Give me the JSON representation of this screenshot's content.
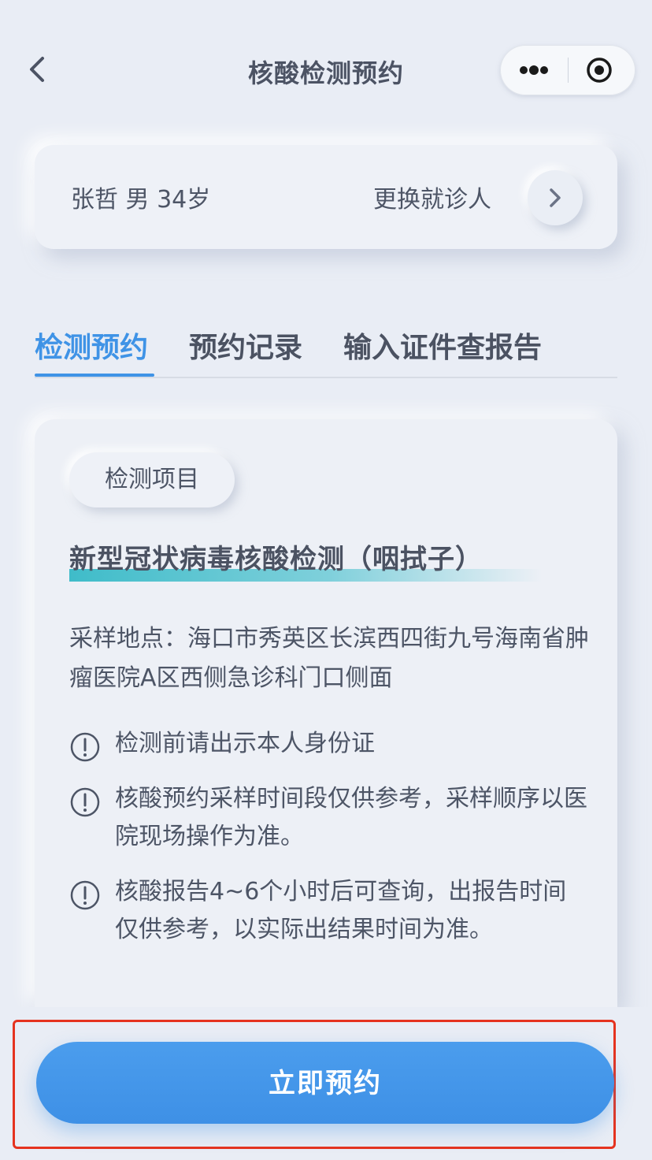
{
  "header": {
    "title": "核酸检测预约"
  },
  "patient": {
    "info": "张哲 男 34岁",
    "switch_label": "更换就诊人"
  },
  "tabs": [
    {
      "label": "检测预约",
      "active": true
    },
    {
      "label": "预约记录",
      "active": false
    },
    {
      "label": "输入证件查报告",
      "active": false
    }
  ],
  "content": {
    "section_label": "检测项目",
    "test_name": "新型冠状病毒核酸检测（咽拭子）",
    "location": "采样地点：海口市秀英区长滨西四街九号海南省肿瘤医院A区西侧急诊科门口侧面",
    "notes": [
      "检测前请出示本人身份证",
      "核酸预约采样时间段仅供参考，采样顺序以医院现场操作为准。",
      "核酸报告4~6个小时后可查询，出报告时间仅供参考，以实际出结果时间为准。"
    ]
  },
  "actions": {
    "book_label": "立即预约"
  },
  "colors": {
    "accent": "#3f93e6",
    "highlight": "#e5331f",
    "background": "#e9edf5",
    "text": "#4d5566"
  }
}
